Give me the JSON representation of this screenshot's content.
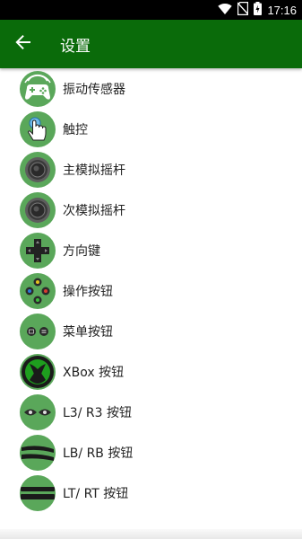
{
  "status_bar": {
    "time": "17:16",
    "icons": [
      "wifi-icon",
      "no-sim-icon",
      "battery-charging-icon"
    ]
  },
  "toolbar": {
    "title": "设置",
    "back_icon": "arrow-back-icon"
  },
  "colors": {
    "toolbar": "#0a6b0a",
    "icon_circle": "#5aa75a"
  },
  "settings": [
    {
      "label": "振动传感器",
      "icon": "gamepad-vibration-icon"
    },
    {
      "label": "触控",
      "icon": "touch-hand-icon"
    },
    {
      "label": "主模拟摇杆",
      "icon": "joystick-icon"
    },
    {
      "label": "次模拟摇杆",
      "icon": "joystick-icon"
    },
    {
      "label": "方向键",
      "icon": "dpad-icon"
    },
    {
      "label": "操作按钮",
      "icon": "action-buttons-icon"
    },
    {
      "label": "菜单按钮",
      "icon": "menu-buttons-icon"
    },
    {
      "label": "XBox 按钮",
      "icon": "xbox-logo-icon"
    },
    {
      "label": "L3/ R3 按钮",
      "icon": "stick-click-icon"
    },
    {
      "label": "LB/ RB 按钮",
      "icon": "bumper-icon"
    },
    {
      "label": "LT/ RT 按钮",
      "icon": "trigger-icon"
    }
  ]
}
